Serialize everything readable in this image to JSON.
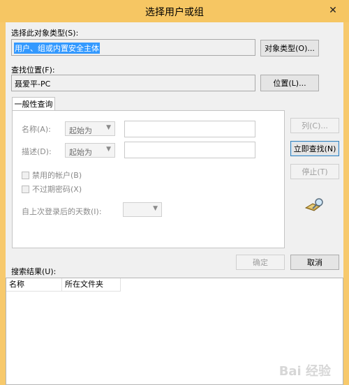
{
  "window": {
    "title": "选择用户或组",
    "close_glyph": "✕"
  },
  "object_type": {
    "label": "选择此对象类型(S):",
    "value": "用户、组或内置安全主体",
    "button": "对象类型(O)..."
  },
  "location": {
    "label": "查找位置(F):",
    "value": "聂爱平-PC",
    "button": "位置(L)..."
  },
  "query_tab": {
    "label": "一般性查询",
    "name_label": "名称(A):",
    "name_mode": "起始为",
    "name_value": "",
    "desc_label": "描述(D):",
    "desc_mode": "起始为",
    "desc_value": "",
    "disabled_accounts_label": "禁用的帐户(B)",
    "non_expiring_label": "不过期密码(X)",
    "days_label": "自上次登录后的天数(I):",
    "days_value": ""
  },
  "side_buttons": {
    "columns": "列(C)...",
    "find_now": "立即查找(N)",
    "stop": "停止(T)"
  },
  "icons": {
    "search_users": "search-users-icon"
  },
  "footer": {
    "results_label": "搜索结果(U):",
    "ok": "确定",
    "cancel": "取消"
  },
  "results_table": {
    "columns": [
      "名称",
      "所在文件夹"
    ],
    "rows": []
  },
  "watermark": "Bai 经验",
  "colors": {
    "title_bar": "#f6c663",
    "selection": "#3399ff",
    "client": "#f0f0f0"
  }
}
